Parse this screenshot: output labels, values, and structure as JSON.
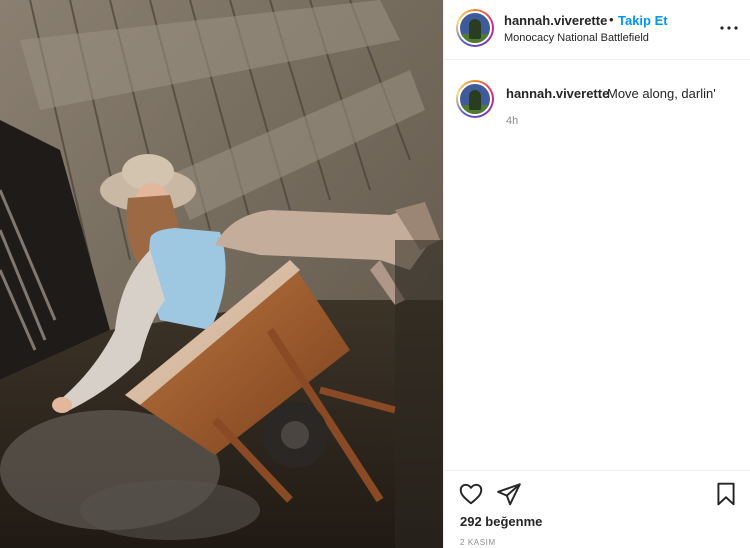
{
  "post": {
    "author": {
      "username": "hannah.viverette",
      "follow_label": "Takip Et",
      "separator": "•",
      "location": "Monocacy National Battlefield"
    },
    "more_icon": "more-horizontal-icon",
    "caption": {
      "username": "hannah.viverette",
      "text": "Move along, darlin'",
      "time": "4h"
    },
    "actions": {
      "like_icon": "heart-icon",
      "share_icon": "paper-plane-icon",
      "save_icon": "bookmark-icon"
    },
    "likes_text": "292 beğenme",
    "date_text": "2 KASIM"
  },
  "colors": {
    "accent": "#0095f6",
    "text": "#262626",
    "muted": "#8e8e8e",
    "divider": "#efefef"
  }
}
